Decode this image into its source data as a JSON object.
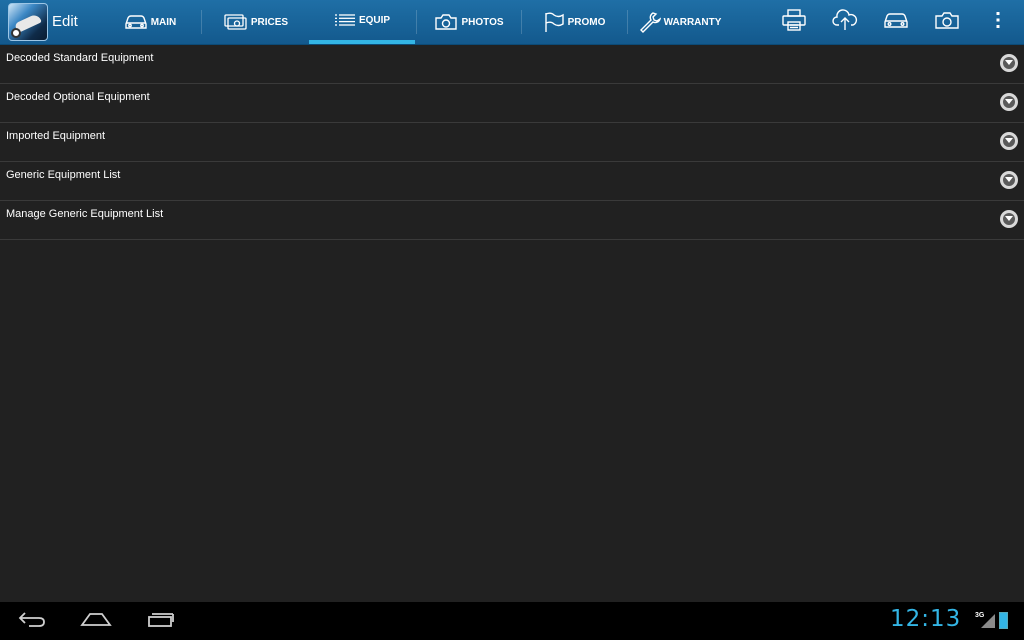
{
  "app": {
    "title": "Edit",
    "icon": "app-logo-icon"
  },
  "tabs": [
    {
      "label": "MAIN",
      "icon": "car-icon",
      "active": false
    },
    {
      "label": "PRICES",
      "icon": "money-icon",
      "active": false
    },
    {
      "label": "EQUIP",
      "icon": "list-icon",
      "active": true
    },
    {
      "label": "PHOTOS",
      "icon": "camera-icon",
      "active": false
    },
    {
      "label": "PROMO",
      "icon": "flag-icon",
      "active": false
    },
    {
      "label": "WARRANTY",
      "icon": "wrench-icon",
      "active": false
    }
  ],
  "actions": [
    "print-icon",
    "cloud-upload-icon",
    "car-icon",
    "camera-icon",
    "overflow-menu-icon"
  ],
  "list": {
    "items": [
      {
        "label": "Decoded Standard Equipment"
      },
      {
        "label": "Decoded Optional Equipment"
      },
      {
        "label": "Imported Equipment"
      },
      {
        "label": "Generic Equipment List"
      },
      {
        "label": "Manage Generic Equipment List"
      }
    ]
  },
  "system_bar": {
    "time": "12:13",
    "network": "3G",
    "nav": [
      "back-icon",
      "home-icon",
      "recent-apps-icon"
    ]
  },
  "colors": {
    "actionbar": "#1a659b",
    "accent": "#33b5e5",
    "background": "#212121"
  }
}
